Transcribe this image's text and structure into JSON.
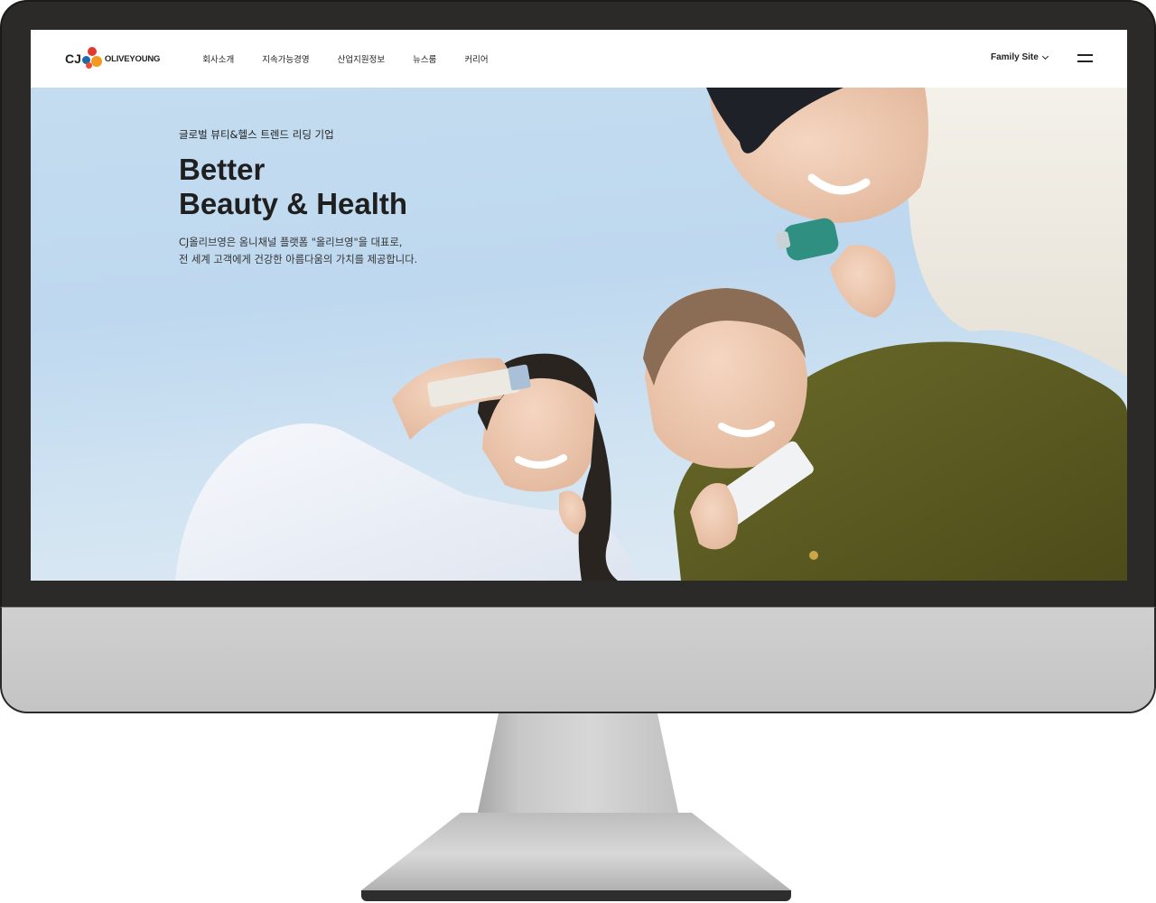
{
  "header": {
    "logo": {
      "cj": "CJ",
      "brand": "OLIVEYOUNG"
    },
    "nav": [
      "회사소개",
      "지속가능경영",
      "산업지원정보",
      "뉴스룸",
      "커리어"
    ],
    "family_site": "Family Site",
    "menu_icon": "hamburger-icon"
  },
  "hero": {
    "eyebrow": "글로벌 뷰티&헬스 트렌드 리딩 기업",
    "headline_1": "Better",
    "headline_2": "Beauty & Health",
    "desc_1": "CJ올리브영은 옴니채널 플랫폼 \"올리브영\"을 대표로,",
    "desc_2": "전 세계 고객에게 건강한 아름다움의 가치를 제공합니다."
  },
  "colors": {
    "logo_blue": "#1a67b3",
    "logo_red": "#e03a2f",
    "logo_orange": "#f29a1f",
    "sky": "#c4dcef",
    "frame": "#2b2a28",
    "chin": "#c8c9c8"
  }
}
